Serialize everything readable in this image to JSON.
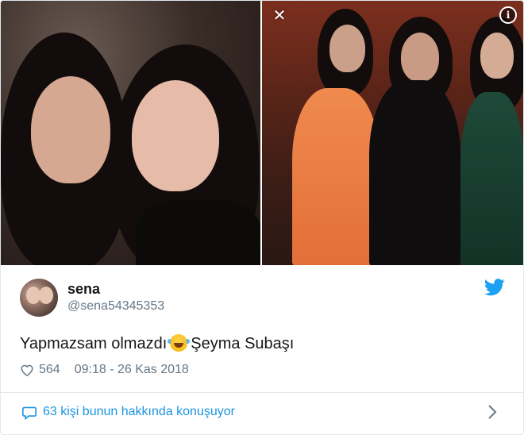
{
  "media": {
    "left_photo": {
      "description_icon": "photo"
    },
    "right_photo": {
      "description_icon": "photo"
    },
    "close_icon": "close-icon",
    "info_icon_glyph": "i"
  },
  "user": {
    "name": "sena",
    "handle": "@sena54345353"
  },
  "tweet": {
    "text_before": "Yapmazsam olmazdı",
    "emoji": "face-with-tears-of-joy",
    "text_after": "Şeyma Subaşı"
  },
  "meta": {
    "likes": "564",
    "timestamp": "09:18 - 26 Kas 2018"
  },
  "footer": {
    "conversation": "63 kişi bunun hakkında konuşuyor"
  },
  "colors": {
    "twitter_blue": "#1da1f2",
    "link_blue": "#1b95e0",
    "muted": "#657786",
    "text": "#14171a",
    "border": "#e1e8ed"
  }
}
